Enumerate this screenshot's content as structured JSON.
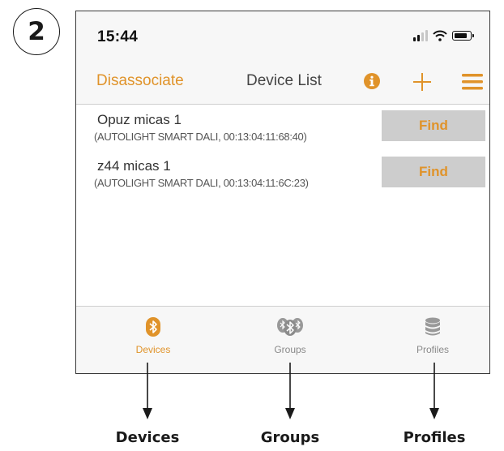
{
  "step_number": "2",
  "status_bar": {
    "time": "15:44",
    "signal_icon": "cellular-signal-icon",
    "wifi_icon": "wifi-icon",
    "battery_icon": "battery-icon"
  },
  "nav": {
    "left_button": "Disassociate",
    "title": "Device List",
    "info_icon": "info-icon",
    "add_icon": "plus-icon",
    "menu_icon": "hamburger-menu-icon"
  },
  "devices": [
    {
      "name": "Opuz micas 1",
      "detail": "(AUTOLIGHT SMART DALI, 00:13:04:11:68:40)",
      "button": "Find"
    },
    {
      "name": "z44 micas 1",
      "detail": "(AUTOLIGHT SMART DALI, 00:13:04:11:6C:23)",
      "button": "Find"
    }
  ],
  "tabs": [
    {
      "label": "Devices",
      "icon": "bluetooth-icon",
      "active": true
    },
    {
      "label": "Groups",
      "icon": "bluetooth-group-icon",
      "active": false
    },
    {
      "label": "Profiles",
      "icon": "database-icon",
      "active": false
    }
  ],
  "captions": {
    "devices": "Devices",
    "groups": "Groups",
    "profiles": "Profiles"
  },
  "colors": {
    "accent": "#e0932a",
    "inactive": "#8a8a8a",
    "button_bg": "#cdcdcd"
  }
}
